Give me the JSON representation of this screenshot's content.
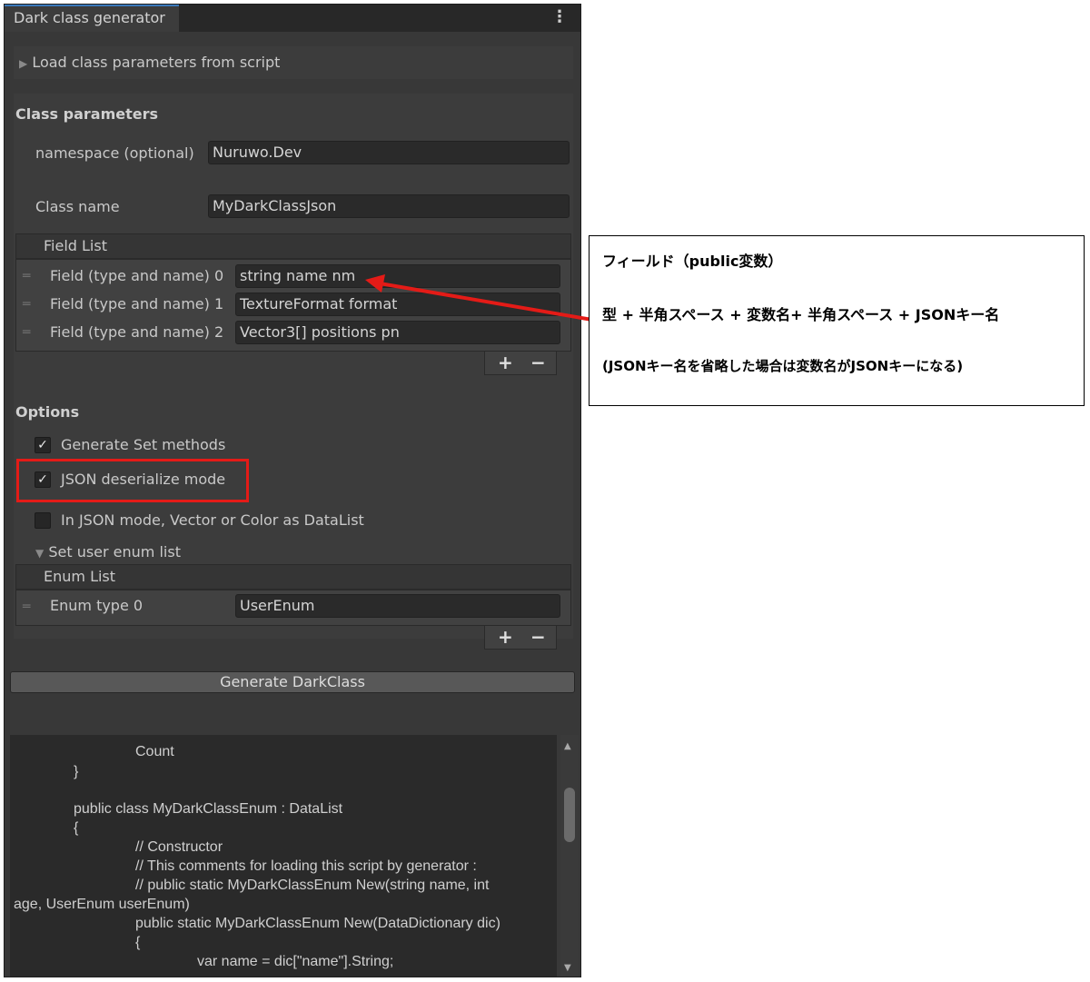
{
  "window": {
    "tab_title": "Dark class generator",
    "menu_icon": "kebab-menu-icon"
  },
  "foldouts": {
    "load_params": "Load class parameters from script",
    "user_enum": "Set user enum list"
  },
  "class_params": {
    "heading": "Class parameters",
    "namespace_label": "namespace (optional)",
    "namespace_value": "Nuruwo.Dev",
    "classname_label": "Class name",
    "classname_value": "MyDarkClassJson"
  },
  "field_list": {
    "title": "Field List",
    "items": [
      {
        "label": "Field (type and name) 0",
        "value": "string name nm"
      },
      {
        "label": "Field (type and name) 1",
        "value": "TextureFormat format"
      },
      {
        "label": "Field (type and name) 2",
        "value": "Vector3[] positions pn"
      }
    ],
    "add": "+",
    "remove": "−"
  },
  "options": {
    "heading": "Options",
    "generate_set": {
      "label": "Generate Set methods",
      "checked": true
    },
    "json_mode": {
      "label": "JSON deserialize mode",
      "checked": true
    },
    "vector_as_list": {
      "label": "In JSON mode, Vector or Color as DataList",
      "checked": false
    }
  },
  "enum_list": {
    "title": "Enum List",
    "items": [
      {
        "label": "Enum type 0",
        "value": "UserEnum"
      }
    ],
    "add": "+",
    "remove": "−"
  },
  "generate_button": "Generate DarkClass",
  "check_mark": "✓",
  "code_lines": [
    "Count",
    "}",
    "public class MyDarkClassEnum : DataList",
    "{",
    "// Constructor",
    "// This comments for loading this script by generator :",
    "// public static MyDarkClassEnum New(string name, int",
    "age, UserEnum userEnum)",
    "public static MyDarkClassEnum New(DataDictionary dic)",
    "{",
    "var name = dic[\"name\"].String;"
  ],
  "annotation": {
    "line1": "フィールド（public変数）",
    "line2": "型 + 半角スペース + 変数名+ 半角スペース + JSONキー名",
    "line3": "(JSONキー名を省略した場合は変数名がJSONキーになる)"
  },
  "colors": {
    "highlight": "#e41b17",
    "panel_bg": "#383838",
    "field_bg": "#2a2a2a"
  }
}
